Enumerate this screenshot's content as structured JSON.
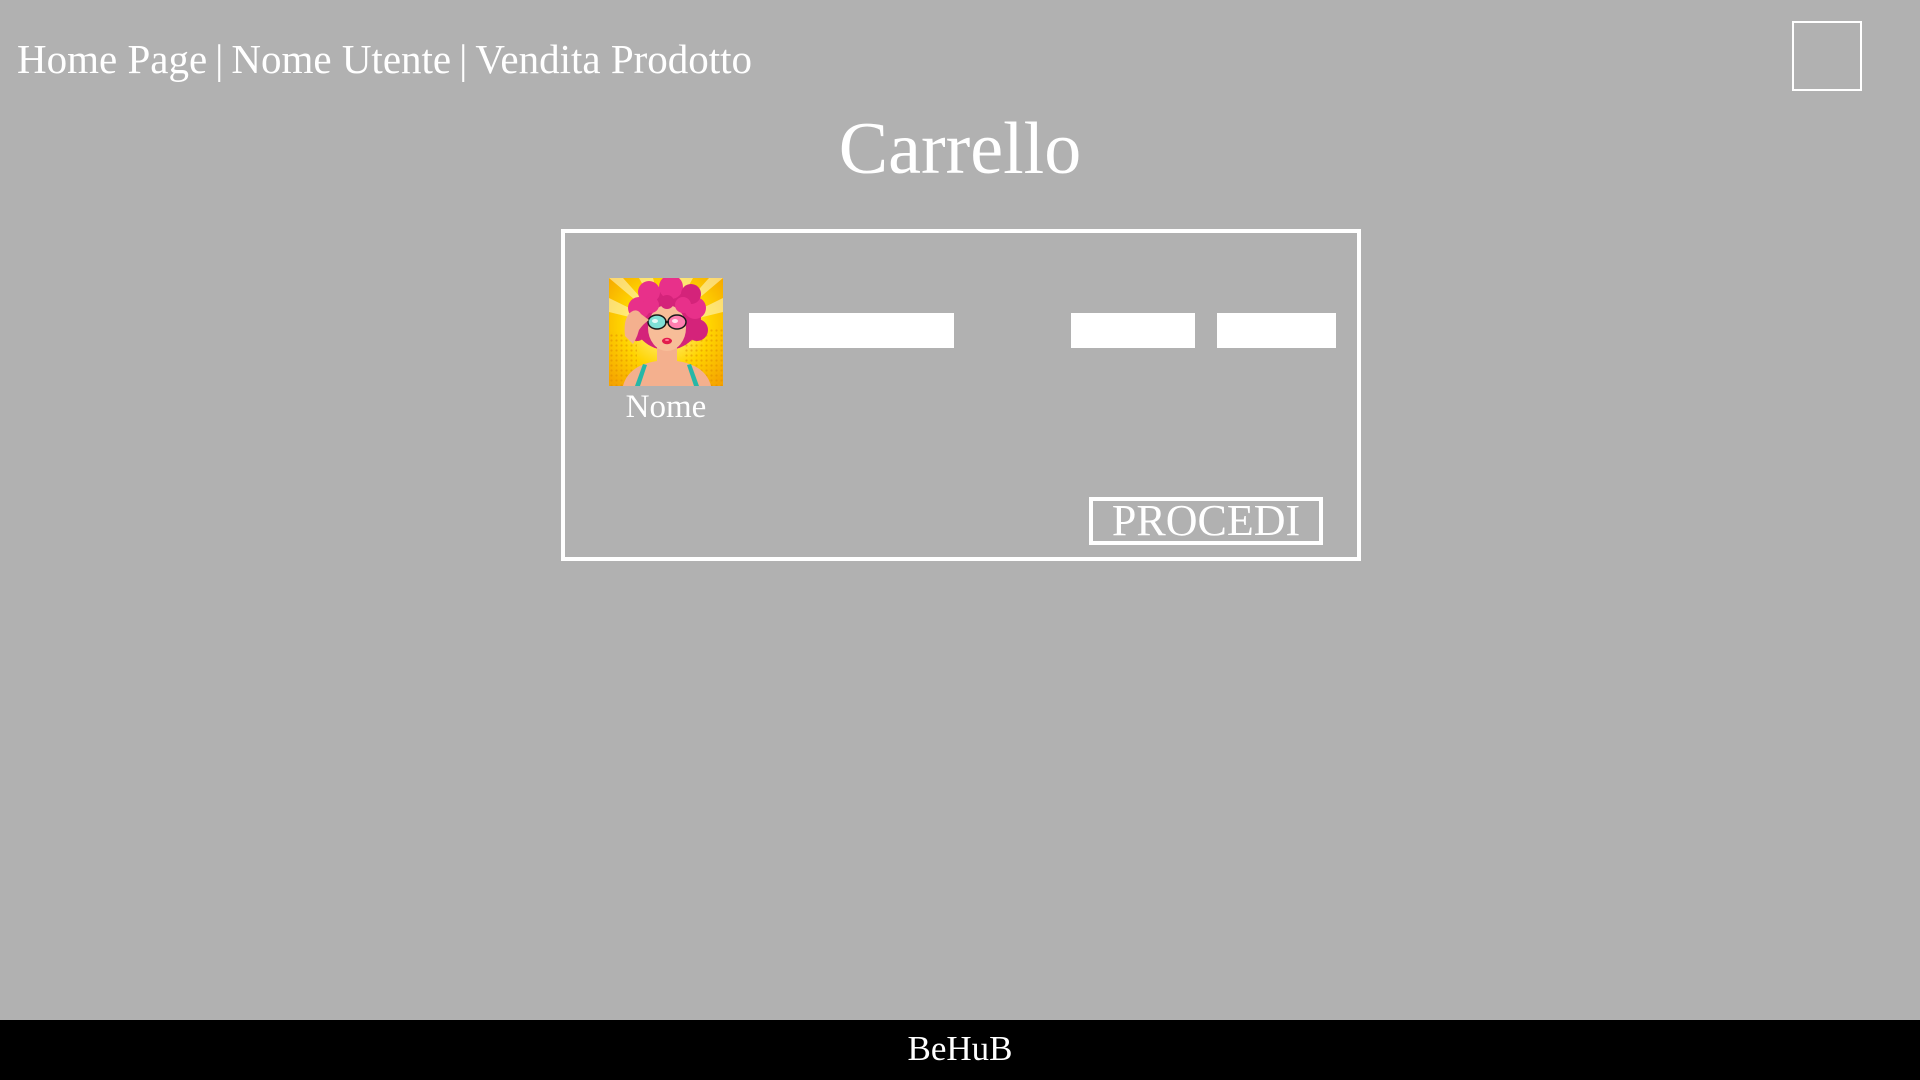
{
  "nav": {
    "home_label": "Home Page",
    "user_label": "Nome Utente",
    "sell_label": "Vendita Prodotto",
    "separator": "|"
  },
  "page": {
    "title": "Carrello"
  },
  "cart": {
    "items": [
      {
        "name": "Nome",
        "image_icon": "product-image-popart-woman",
        "name_field_value": "",
        "qty_field_value": "",
        "price_field_value": ""
      }
    ],
    "proceed_label": "PROCEDI"
  },
  "footer": {
    "brand": "BeHuB"
  },
  "colors": {
    "background": "#b1b1b1",
    "foreground": "#ffffff",
    "footer_background": "#000000"
  }
}
